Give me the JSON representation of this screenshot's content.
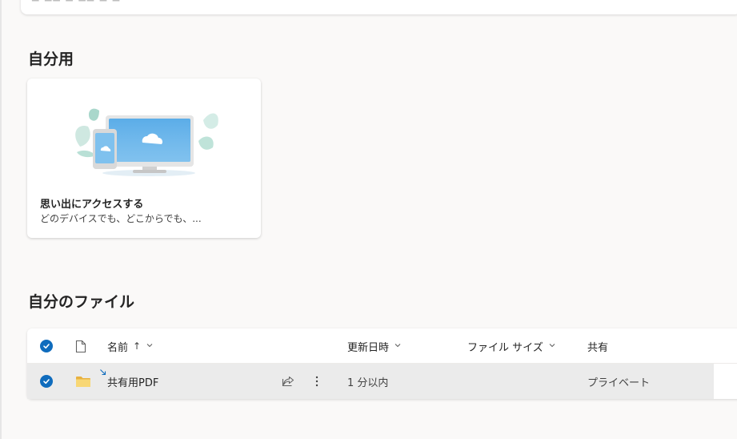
{
  "sections": {
    "personal_title": "自分用",
    "files_title": "自分のファイル"
  },
  "memory_card": {
    "title": "思い出にアクセスする",
    "description": "どのデバイスでも、どこからでも、..."
  },
  "table": {
    "columns": {
      "name": "名前",
      "name_sort": "↑",
      "modified": "更新日時",
      "size": "ファイル サイズ",
      "sharing": "共有"
    },
    "rows": [
      {
        "name": "共有用PDF",
        "modified": "1 分以内",
        "size": "",
        "sharing": "プライベート",
        "icon": "folder-icon"
      }
    ]
  },
  "colors": {
    "accent": "#0f6cbd",
    "folder": "#f8d775",
    "background": "#faf9f8"
  }
}
